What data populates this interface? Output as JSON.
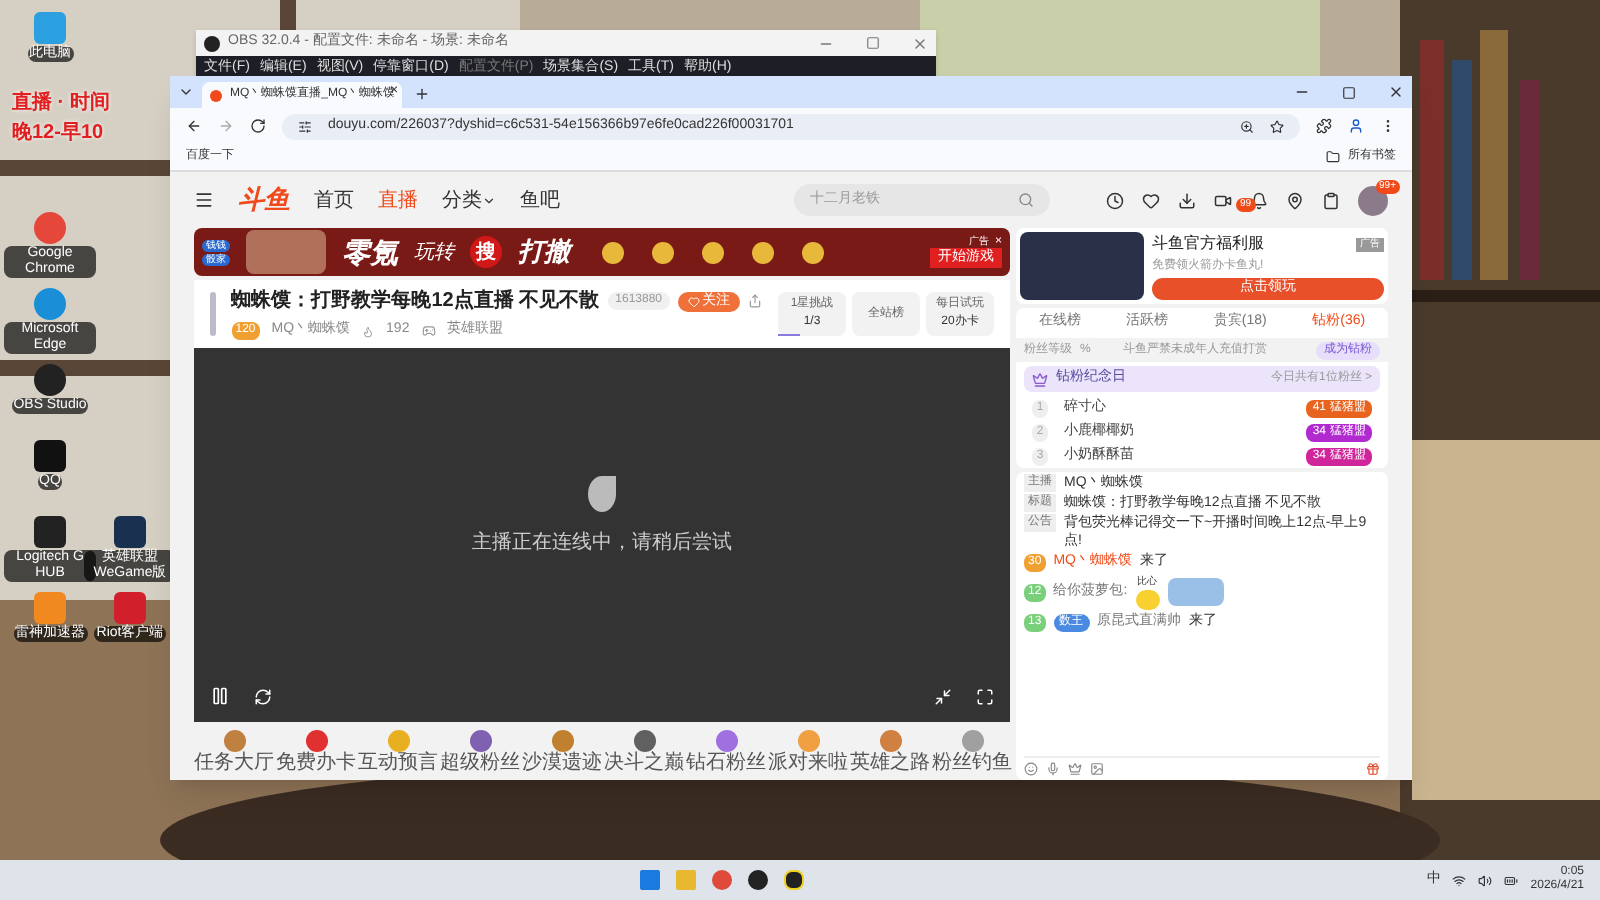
{
  "desktop": {
    "overlay_lines": [
      "直播 · 时间",
      "晚12-早10"
    ],
    "icons": [
      {
        "label": "此电脑",
        "kind": "pc"
      },
      {
        "label": "Google Chrome",
        "kind": "chrome"
      },
      {
        "label": "Microsoft Edge",
        "kind": "edge"
      },
      {
        "label": "OBS Studio",
        "kind": "obs"
      },
      {
        "label": "QQ",
        "kind": "qq"
      },
      {
        "label": "Logitech G HUB",
        "kind": "ghub"
      },
      {
        "label": "雷神加速器",
        "kind": "leishen"
      },
      {
        "label": "英雄联盟WeGame版",
        "kind": "lol"
      },
      {
        "label": "Riot客户端",
        "kind": "riot"
      }
    ]
  },
  "obs_window": {
    "title": "OBS 32.0.4 - 配置文件: 未命名 - 场景: 未命名",
    "menu": [
      {
        "label": "文件(F)",
        "disabled": false
      },
      {
        "label": "编辑(E)",
        "disabled": false
      },
      {
        "label": "视图(V)",
        "disabled": false
      },
      {
        "label": "停靠窗口(D)",
        "disabled": false
      },
      {
        "label": "配置文件(P)",
        "disabled": true
      },
      {
        "label": "场景集合(S)",
        "disabled": false
      },
      {
        "label": "工具(T)",
        "disabled": false
      },
      {
        "label": "帮助(H)",
        "disabled": false
      }
    ]
  },
  "browser": {
    "tab_title": "MQ丶蜘蛛馍直播_MQ丶蜘蛛馍",
    "tab_close": "×",
    "url": "douyu.com/226037?dyshid=c6c531-54e156366b97e6fe0cad226f00031701",
    "bookmarks": [
      "百度一下"
    ],
    "all_bookmarks": "所有书签"
  },
  "site": {
    "logo": "斗鱼",
    "nav": [
      {
        "label": "首页",
        "selected": false,
        "dropdown": false
      },
      {
        "label": "直播",
        "selected": true,
        "dropdown": false
      },
      {
        "label": "分类",
        "selected": false,
        "dropdown": true
      },
      {
        "label": "鱼吧",
        "selected": false,
        "dropdown": false
      }
    ],
    "search": {
      "placeholder": "十二月老铁"
    },
    "notification_badge": "99",
    "avatar_badge": "99+"
  },
  "banner": {
    "tags": [
      "钱钱",
      "骰家"
    ],
    "headline": "零氪",
    "sub": "玩转",
    "circle": "搜",
    "tail": "打撤",
    "cta": "开始游戏",
    "ad": "广告",
    "close": "×"
  },
  "stream": {
    "title": "蜘蛛馍：打野教学每晚12点直播 不见不散",
    "followers": "1613880",
    "follow": "关注",
    "level": "120",
    "host": "MQ丶蜘蛛馍",
    "heat": "192",
    "category": "英雄联盟",
    "boxes": [
      {
        "label": "1星挑战",
        "value": "1/3",
        "level": 0.33
      },
      {
        "label": "全站榜"
      },
      {
        "label": "每日试玩",
        "value": "20办卡"
      }
    ],
    "status": "主播正在连线中，请稍后尝试",
    "paused": false
  },
  "gifts": [
    "任务大厅",
    "免费办卡",
    "互动预言",
    "超级粉丝",
    "沙漠遗迹",
    "决斗之巅",
    "钻石粉丝",
    "派对来啦",
    "英雄之路",
    "粉丝钓鱼"
  ],
  "side_ad": {
    "title": "斗鱼官方福利服",
    "desc": "免费领火箭办卡鱼丸!",
    "button": "点击领玩",
    "ad": "广告"
  },
  "rank_tabs": [
    {
      "label": "在线榜",
      "selected": false
    },
    {
      "label": "活跃榜",
      "selected": false
    },
    {
      "label": "贵宾(18)",
      "selected": false
    },
    {
      "label": "钻粉(36)",
      "selected": true
    }
  ],
  "fan_bar": {
    "label": "粉丝等级",
    "percent": "%",
    "notice": "斗鱼严禁未成年人充值打赏",
    "button": "成为钻粉"
  },
  "memorial": {
    "title": "钻粉纪念日",
    "count": "今日共有1位粉丝 >"
  },
  "fans": [
    {
      "rank": "1",
      "name": "碎寸心",
      "level": "41",
      "club": "猛猪盟",
      "color": "#e8641e"
    },
    {
      "rank": "2",
      "name": "小鹿椰椰奶",
      "level": "34",
      "club": "猛猪盟",
      "color": "#b02ad0"
    },
    {
      "rank": "3",
      "name": "小奶酥酥苗",
      "level": "34",
      "club": "猛猪盟",
      "color": "#d0249a"
    }
  ],
  "chat": [
    {
      "kind": "info",
      "tag": "主播",
      "text": "MQ丶蜘蛛馍"
    },
    {
      "kind": "info",
      "tag": "标题",
      "text": "蜘蛛馍：打野教学每晚12点直播 不见不散"
    },
    {
      "kind": "info",
      "tag": "公告",
      "text": "背包荧光棒记得交一下~开播时间晚上12点-早上9点!"
    },
    {
      "kind": "enter",
      "badge": "30",
      "user": "MQ丶蜘蛛馍",
      "text": "来了"
    },
    {
      "kind": "sticker",
      "badge": "12",
      "text": "给你菠萝包:",
      "sticker_text": "比心"
    },
    {
      "kind": "enter_noble",
      "badge": "13",
      "noble": "数王",
      "user": "原昆式直满帅",
      "text": "来了"
    }
  ],
  "taskbar": {
    "ime": "中",
    "time": "0:05",
    "date": "2026/4/21"
  }
}
